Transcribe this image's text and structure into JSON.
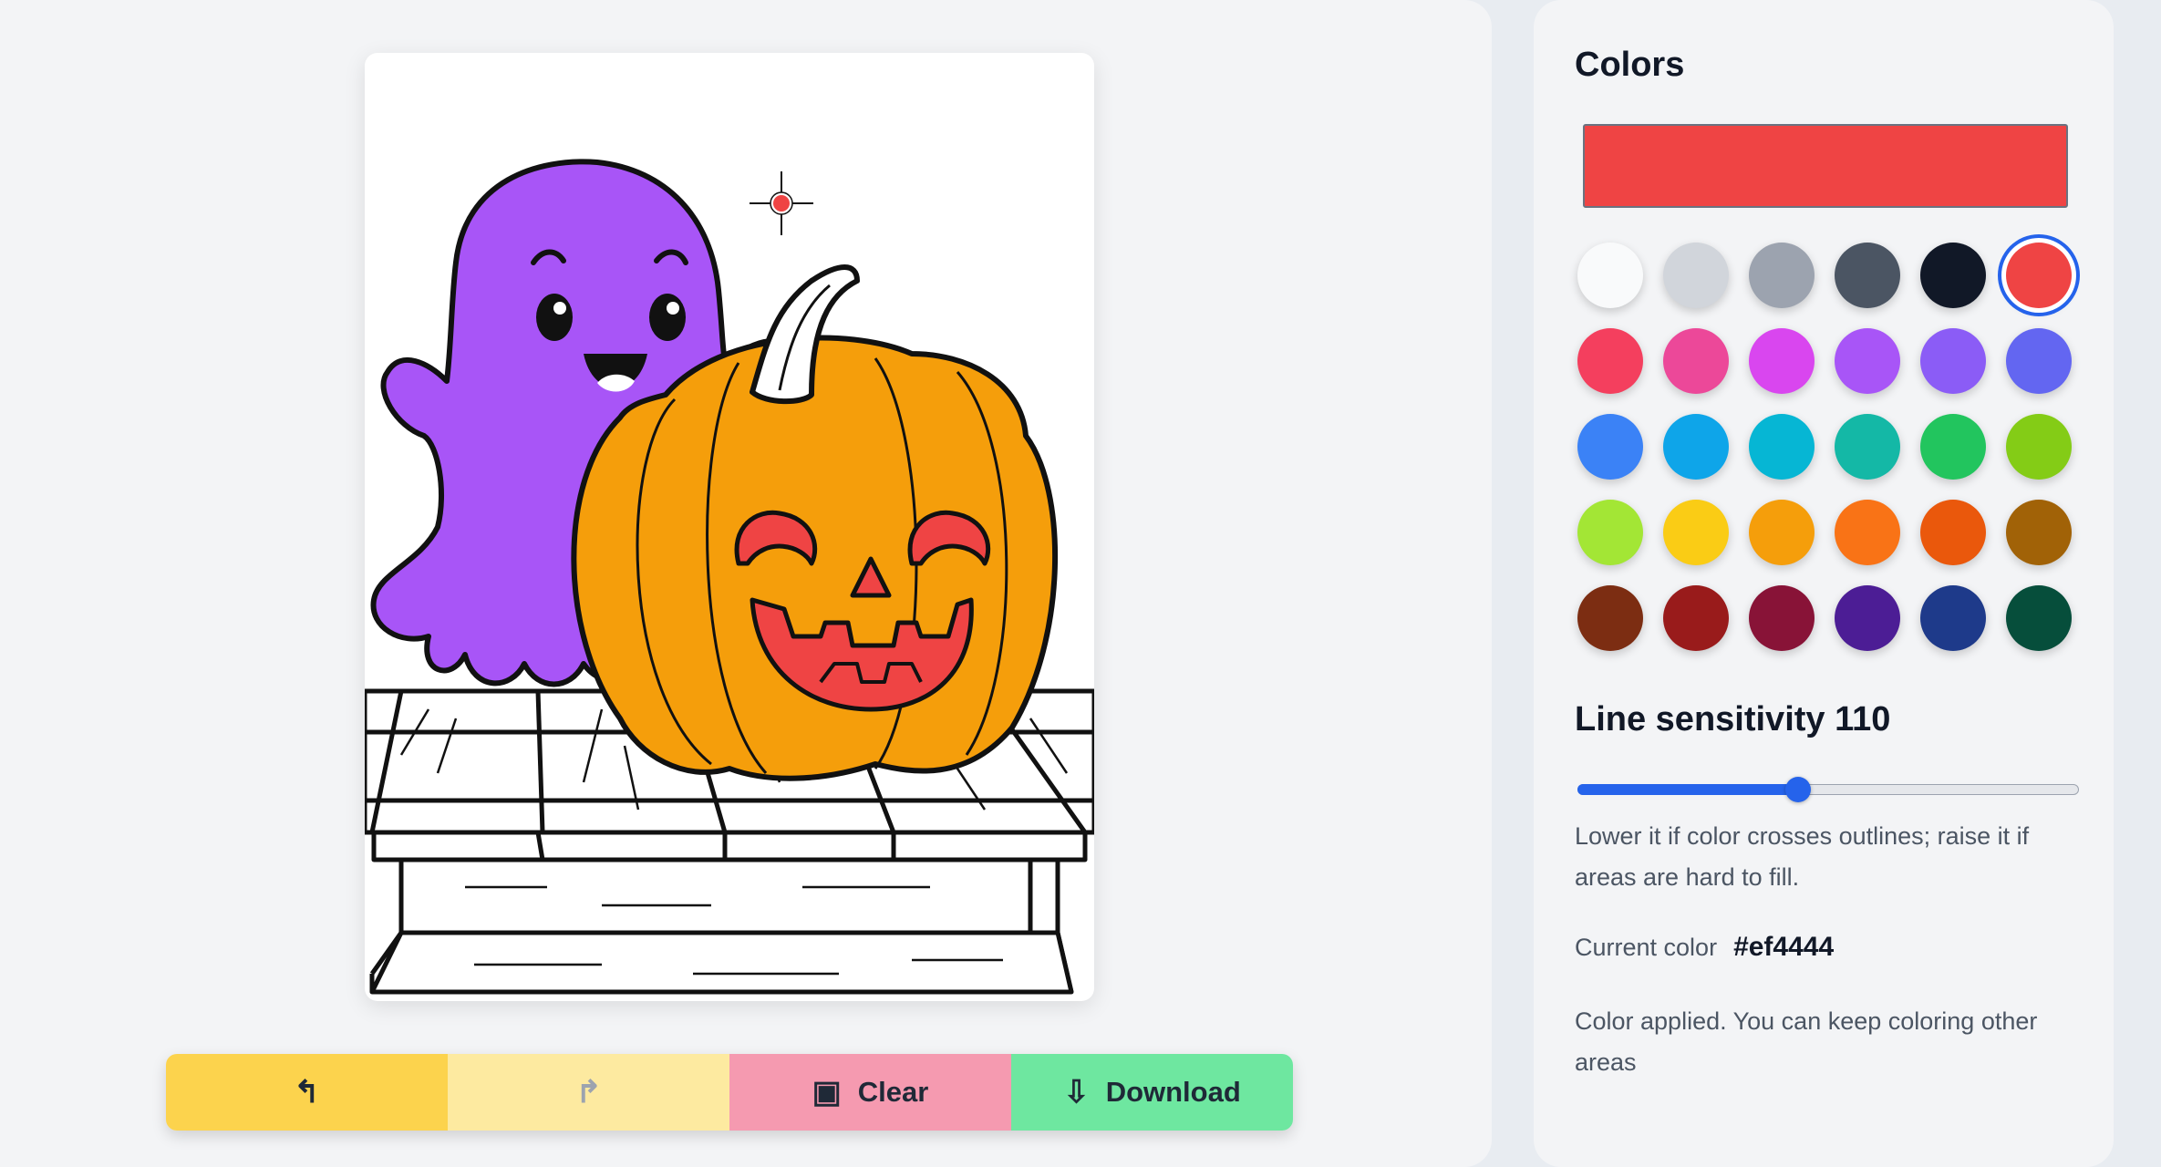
{
  "colors_panel": {
    "title": "Colors",
    "current_color_hex": "#ef4444",
    "palette": [
      "#f9fafb",
      "#d1d5db",
      "#9ca3af",
      "#4b5563",
      "#111827",
      "#ef4444",
      "#f43f5e",
      "#ec4899",
      "#d946ef",
      "#a855f7",
      "#8b5cf6",
      "#6366f1",
      "#3b82f6",
      "#0ea5e9",
      "#06b6d4",
      "#14b8a6",
      "#22c55e",
      "#84cc16",
      "#a3e635",
      "#facc15",
      "#f59e0b",
      "#f97316",
      "#ea580c",
      "#a16207",
      "#7c2d12",
      "#991b1b",
      "#881337",
      "#4c1d95",
      "#1e3a8a",
      "#064e3b"
    ],
    "selected_index": 5
  },
  "sensitivity": {
    "label": "Line sensitivity",
    "value": "110",
    "slider_fraction": 0.44,
    "help_text": "Lower it if color crosses outlines; raise it if areas are hard to fill."
  },
  "current_color": {
    "label": "Current color",
    "value": "#ef4444"
  },
  "status": {
    "message": "Color applied. You can keep coloring other areas"
  },
  "toolbar": {
    "undo_icon": "↰",
    "redo_icon": "↱",
    "clear_icon": "▣",
    "clear_label": "Clear",
    "download_icon": "⇩",
    "download_label": "Download"
  },
  "icons": {
    "undo": "undo-icon",
    "redo": "redo-icon",
    "clear": "clear-icon",
    "download": "download-icon",
    "cursor": "crosshair-cursor-icon"
  },
  "artwork_colors": {
    "ghost": "#a855f7",
    "pumpkin": "#f59e0b",
    "face": "#ef4444",
    "stem": "#ffffff",
    "outline": "#111111"
  }
}
